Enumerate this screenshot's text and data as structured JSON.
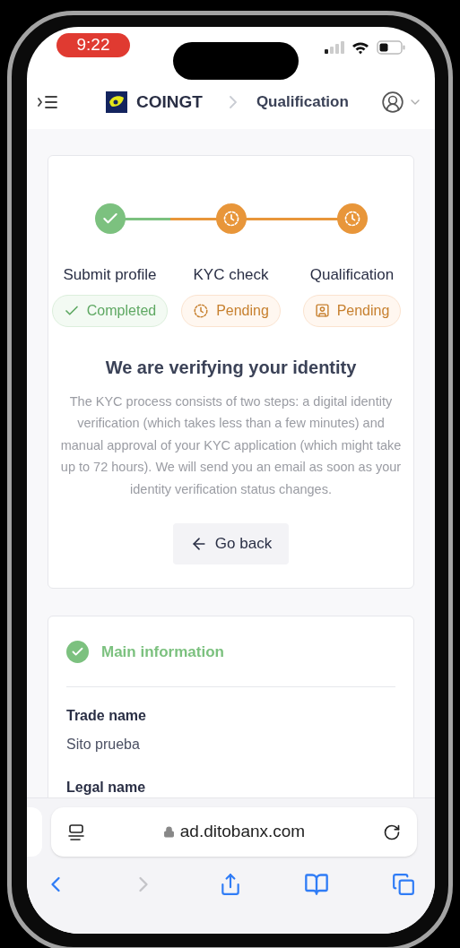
{
  "status_bar": {
    "time": "9:22"
  },
  "header": {
    "brand": "COINGT",
    "breadcrumb": "Qualification"
  },
  "progress": {
    "steps": [
      {
        "label": "Submit profile",
        "completed": true,
        "badge": {
          "label": "Completed",
          "kind": "check"
        }
      },
      {
        "label": "KYC check",
        "completed": false,
        "badge": {
          "label": "Pending",
          "kind": "clock"
        }
      },
      {
        "label": "Qualification",
        "completed": false,
        "badge": {
          "label": "Pending",
          "kind": "badge"
        }
      }
    ],
    "title": "We are verifying your identity",
    "description": "The KYC process consists of two steps: a digital identity verification (which takes less than a few minutes) and manual approval of your KYC application (which might take up to 72 hours). We will send you an email as soon as your identity verification status changes.",
    "button": "Go back"
  },
  "main_information": {
    "title": "Main information",
    "completed": true,
    "fields": [
      {
        "label": "Trade name",
        "value": "Sito prueba"
      },
      {
        "label": "Legal name"
      }
    ]
  },
  "browser": {
    "url": "ad.ditobanx.com"
  }
}
